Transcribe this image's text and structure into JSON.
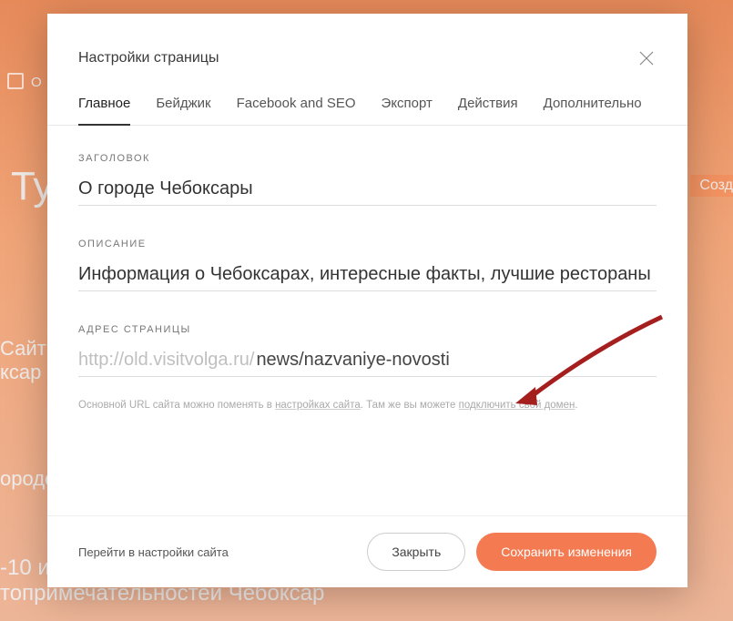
{
  "modal": {
    "title": "Настройки страницы",
    "tabs": [
      {
        "label": "Главное",
        "active": true
      },
      {
        "label": "Бейджик",
        "active": false
      },
      {
        "label": "Facebook and SEO",
        "active": false
      },
      {
        "label": "Экспорт",
        "active": false
      },
      {
        "label": "Действия",
        "active": false
      },
      {
        "label": "Дополнительно",
        "active": false
      }
    ],
    "fields": {
      "title_label": "ЗАГОЛОВОК",
      "title_value": "О городе Чебоксары",
      "desc_label": "ОПИСАНИЕ",
      "desc_value": "Информация о Чебоксарах, интересные факты, лучшие рестораны",
      "url_label": "АДРЕС СТРАНИЦЫ",
      "url_prefix": "http://old.visitvolga.ru/",
      "url_value": "news/nazvaniye-novosti"
    },
    "hint": {
      "p1": "Основной URL сайта можно поменять в ",
      "link1": "настройках сайта",
      "p2": ". Там же вы можете ",
      "link2": "подключить свой домен",
      "p3": "."
    },
    "footer": {
      "settings_link": "Перейти в настройки сайта",
      "close_label": "Закрыть",
      "save_label": "Сохранить изменения"
    }
  },
  "background": {
    "publish": "О",
    "typ": "Тур",
    "sozd": "Созд",
    "site": "Сайт",
    "site2": "ксар",
    "gorod": "ороде",
    "b1": "-10 и",
    "b2": "топримечательностей Чебоксар"
  }
}
